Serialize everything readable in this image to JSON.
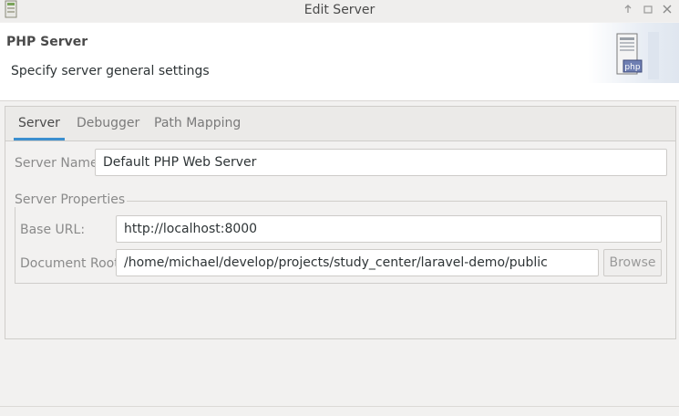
{
  "window": {
    "title": "Edit Server",
    "controls": [
      "arrow-up-icon",
      "maximize-icon",
      "close-icon"
    ]
  },
  "header": {
    "title": "PHP Server",
    "description": "Specify server general settings",
    "icon": "php-server-icon",
    "icon_text": "php"
  },
  "tabs": [
    {
      "label": "Server",
      "active": true
    },
    {
      "label": "Debugger",
      "active": false
    },
    {
      "label": "Path Mapping",
      "active": false
    }
  ],
  "server": {
    "name_label": "Server Name:",
    "name_value": "Default PHP Web Server",
    "properties_legend": "Server Properties",
    "base_url_label": "Base URL:",
    "base_url_value": "http://localhost:8000",
    "doc_root_label": "Document Root:",
    "doc_root_value": "/home/michael/develop/projects/study_center/laravel-demo/public",
    "browse_label": "Browse"
  },
  "colors": {
    "accent": "#3b8fcf",
    "background": "#f2f1f0"
  }
}
